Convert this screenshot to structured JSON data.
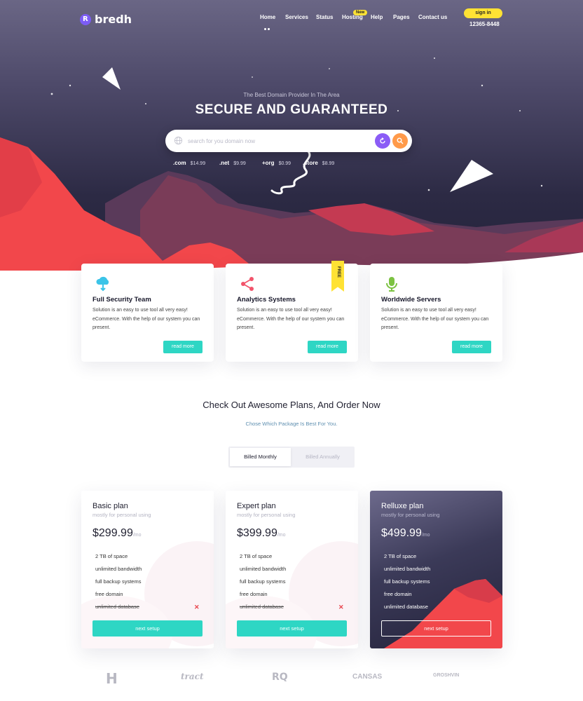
{
  "header": {
    "logo_text": "bredh",
    "nav": [
      {
        "label": "Home"
      },
      {
        "label": "Services"
      },
      {
        "label": "Status"
      },
      {
        "label": "Hosting",
        "badge": "New"
      },
      {
        "label": "Help"
      },
      {
        "label": "Pages"
      },
      {
        "label": "Contact us"
      }
    ],
    "signin_label": "sign in",
    "phone": "12365-8448"
  },
  "hero": {
    "subtitle": "The Best Domain Provider In The Area",
    "title": "SECURE AND GUARANTEED",
    "search_placeholder": "search for you domain now",
    "tlds": [
      {
        "ext": ".com",
        "price": "$14.99"
      },
      {
        "ext": ".net",
        "price": "$9.99"
      },
      {
        "ext": "+org",
        "price": "$0.99"
      },
      {
        "ext": ".store",
        "price": "$8.99"
      }
    ]
  },
  "features": [
    {
      "title": "Full Security Team",
      "text": "Solution is an easy to use tool all very easy! eCommerce. With the help of our system you can present.",
      "button": "read more",
      "icon": "cloud-upload-icon",
      "icon_color": "#3bc4e8"
    },
    {
      "title": "Analytics Systems",
      "text": "Solution is an easy to use tool all very easy! eCommerce. With the help of our system you can present.",
      "button": "read more",
      "icon": "share-icon",
      "icon_color": "#f2546b",
      "ribbon": "FREE"
    },
    {
      "title": "Worldwide Servers",
      "text": "Solution is an easy to use tool all very easy! eCommerce. With the help of our system you can present.",
      "button": "read more",
      "icon": "microphone-icon",
      "icon_color": "#7cc242"
    }
  ],
  "plans_section": {
    "title": "Check Out Awesome Plans, And Order Now",
    "subtitle": "Chose Which Package Is Best For You.",
    "billing": {
      "monthly": "Billed Monthly",
      "annually": "Billed Annually",
      "selected": "Billed Monthly"
    }
  },
  "plans": [
    {
      "name": "Basic plan",
      "tagline": "mostly for personal using",
      "price": "$299.99",
      "period": "/mo",
      "features": [
        "2 TB of space",
        "unlimited bandwidth",
        "full backup systems",
        "free domain",
        "unlimited database"
      ],
      "struck": "unlimited database",
      "button": "next setup"
    },
    {
      "name": "Expert plan",
      "tagline": "mostly for personal using",
      "price": "$399.99",
      "period": "/mo",
      "features": [
        "2 TB of space",
        "unlimited bandwidth",
        "full backup systems",
        "free domain",
        "unlimited database"
      ],
      "struck": "unlimited database",
      "button": "next setup"
    },
    {
      "name": "Relluxe plan",
      "tagline": "mostly for personal using",
      "price": "$499.99",
      "period": "/mo",
      "features": [
        "2 TB of space",
        "unlimited bandwidth",
        "full backup systems",
        "free domain",
        "unlimited database"
      ],
      "button": "next setup"
    }
  ],
  "brands": [
    {
      "name": "H"
    },
    {
      "name": "tract"
    },
    {
      "name": "RQ"
    },
    {
      "name": "CANSAS"
    },
    {
      "name": "GROSHVIN"
    }
  ],
  "colors": {
    "accent": "#2ed6c4",
    "yellow": "#ffe234",
    "purple": "#8b5cf6",
    "orange": "#ff9a4a",
    "mountain": "#f2474b"
  }
}
